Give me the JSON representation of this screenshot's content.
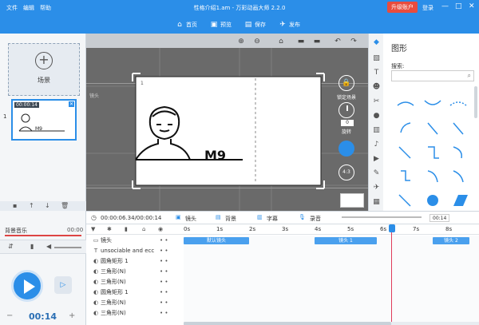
{
  "titlebar": {
    "menu_file": "文件",
    "menu_edit": "编辑",
    "menu_help": "帮助",
    "title": "性格介绍1.am - 万彩动画大师 2.2.0",
    "upgrade": "升级账户",
    "login": "登录",
    "min": "—",
    "max": "□",
    "close": "✕"
  },
  "toolbar": {
    "home": "首页",
    "preview": "预览",
    "save": "保存",
    "publish": "发布"
  },
  "scenes": {
    "add_label": "场景",
    "thumb_index": "1",
    "thumb_time": "00:00:14",
    "thumb_text": "M9"
  },
  "stage": {
    "scene_number": "1",
    "lens_label": "镜头",
    "lock_label": "锁定场景",
    "rotate_label": "旋转",
    "rotate_value": "0",
    "ratio_label": "4:3",
    "canvas_text": "M9"
  },
  "shapes": {
    "title": "图形",
    "search_label": "搜索:"
  },
  "timeline": {
    "time_display": "00:00:06.34/00:00:14",
    "tab_lens": "镜头",
    "tab_bg": "背景",
    "tab_caption": "字幕",
    "tab_record": "录音",
    "zoom_value": "00:14",
    "ticks": [
      "0s",
      "1s",
      "2s",
      "3s",
      "4s",
      "5s",
      "6s",
      "7s",
      "8s"
    ],
    "rows": [
      {
        "label": "镜头"
      },
      {
        "label": "unsociable and ecc"
      },
      {
        "label": "圆角矩形 1"
      },
      {
        "label": "三角形(N)"
      },
      {
        "label": "三角形(N)"
      },
      {
        "label": "圆角矩形 1"
      },
      {
        "label": "三角形(N)"
      },
      {
        "label": "三角形(N)"
      }
    ],
    "bar_default": "默认镜头",
    "bar_lens1": "镜头 1",
    "bar_lens2": "镜头 2"
  },
  "audio": {
    "bg_music": "背景音乐",
    "bg_time": "00:00",
    "duration": "00:14"
  },
  "colors": {
    "brand": "#2b8ee8",
    "upgrade": "#e84c3d",
    "playhead": "#e03b5a"
  }
}
